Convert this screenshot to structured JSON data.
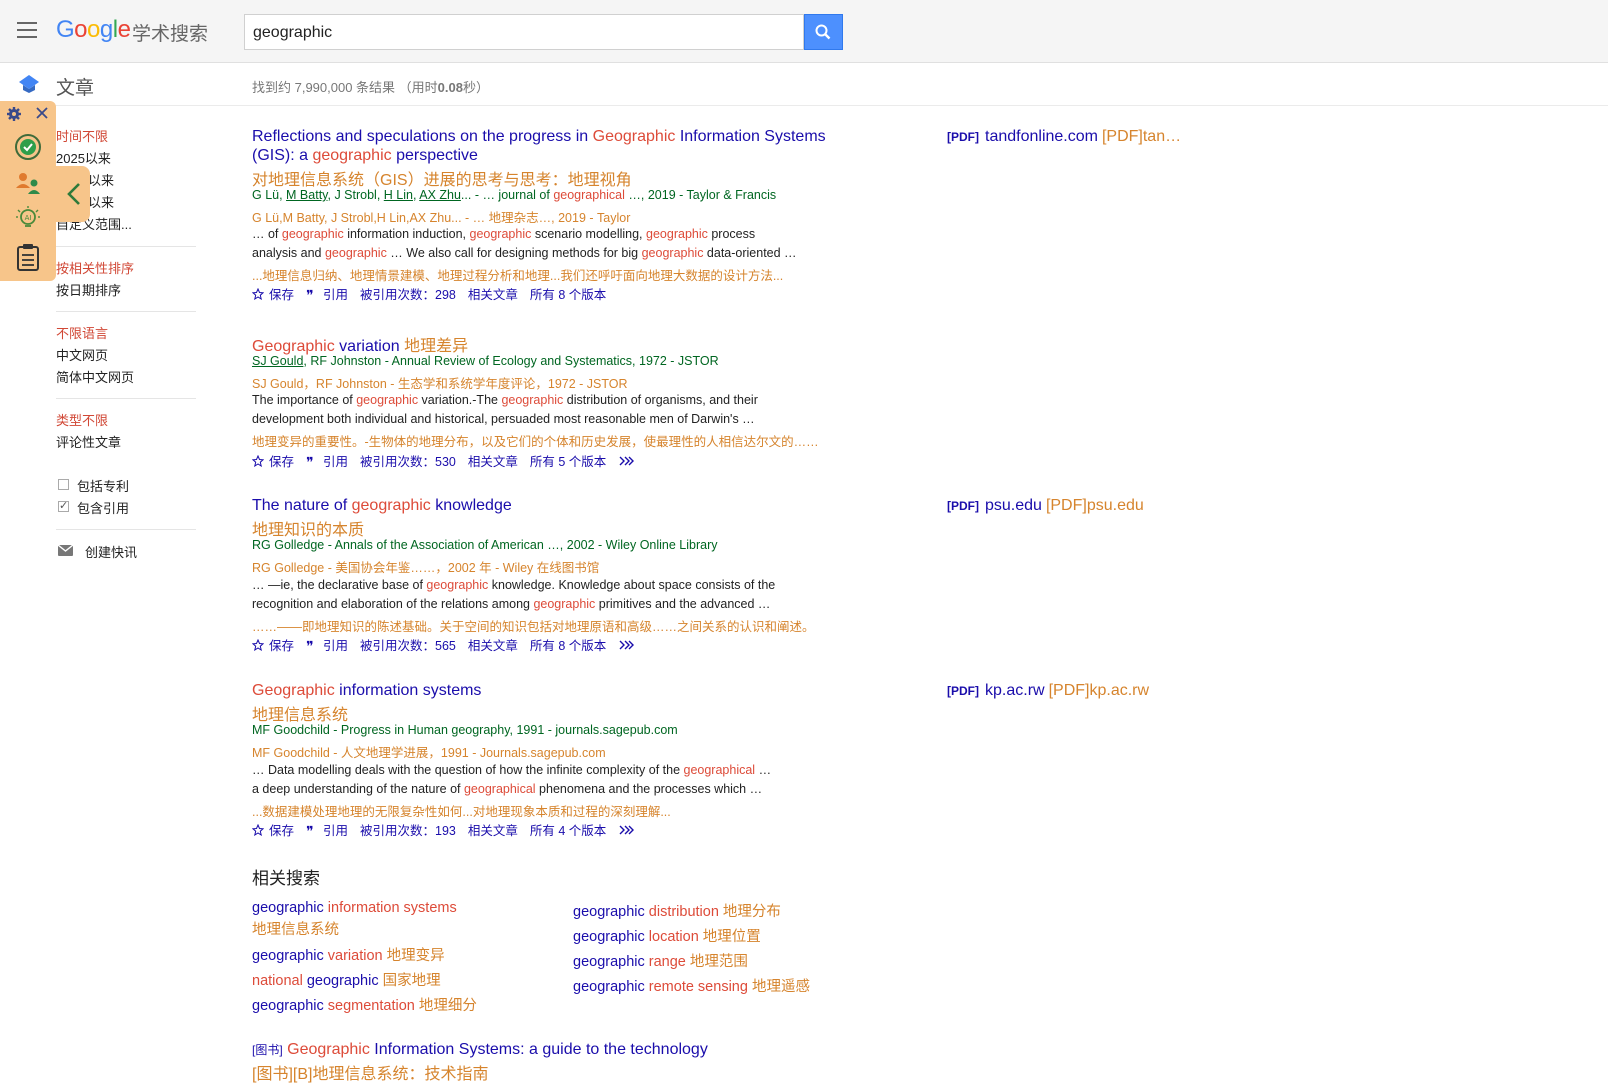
{
  "header": {
    "logo_google": "Google",
    "logo_sub": "学术搜索",
    "search_value": "geographic"
  },
  "subheader": {
    "section_title": "文章",
    "result_count_prefix": "找到约 7,990,000 条结果 （用时",
    "result_time": "0.08",
    "result_count_suffix": "秒）"
  },
  "sidebar": {
    "time_any": "时间不限",
    "since_2025": "2025以来",
    "since_b": "以来",
    "since_c": "以来",
    "custom_range": "自定义范围...",
    "sort_relevance": "按相关性排序",
    "sort_date": "按日期排序",
    "lang_any": "不限语言",
    "lang_zh": "中文网页",
    "lang_zh_simplified": "简体中文网页",
    "type_any": "类型不限",
    "type_review": "评论性文章",
    "include_patents": "包括专利",
    "include_citations": "包含引用",
    "create_alert": "创建快讯"
  },
  "results": [
    {
      "title_pre": "Reflections and speculations on the progress in ",
      "title_hl": "Geographic",
      "title_post": " Information Systems",
      "title_line2_pre": "(GIS): a ",
      "title_line2_hl": "geographic",
      "title_line2_post": " perspective",
      "title_tr": "对地理信息系统（GIS）进展的思考与思考：地理视角",
      "authors_plain1": "G Lü, ",
      "author_u1": "M Batty",
      "authors_plain2": ", J Strobl, ",
      "author_u2": "H Lin",
      "authors_plain3": ", ",
      "author_u3": "AX Zhu",
      "meta_rest_a": "... - … journal of ",
      "meta_hl": "geographical",
      "meta_rest_b": " …, 2019 - Taylor & Francis",
      "meta_tr": "G Lü,M Batty, J Strobl,H Lin,AX Zhu... - … 地理杂志…, 2019 - Taylor",
      "snip1_a": "… of ",
      "snip1_h1": "geographic",
      "snip1_b": " information induction, ",
      "snip1_h2": "geographic",
      "snip1_c": " scenario modelling, ",
      "snip1_h3": "geographic",
      "snip1_d": " process",
      "snip2_a": "analysis and ",
      "snip2_h1": "geographic",
      "snip2_b": " … We also call for designing methods for big ",
      "snip2_h2": "geographic",
      "snip2_c": " data-oriented …",
      "snip_tr": "...地理信息归纳、地理情景建模、地理过程分析和地理...我们还呼吁面向地理大数据的设计方法...",
      "save": "保存",
      "cite": "引用",
      "cited_by": "被引用次数：298",
      "related": "相关文章",
      "versions": "所有 8 个版本",
      "pdf_label": "[PDF]",
      "pdf_domain": "tandfonline.com",
      "pdf_tr": "[PDF]tan…"
    },
    {
      "title_hl": "Geographic",
      "title_post": " variation ",
      "title_tr_inline": "地理差异",
      "author_u1": "SJ Gould",
      "meta_rest": ", RF Johnston - Annual Review of Ecology and Systematics, 1972 - JSTOR",
      "meta_tr": "SJ Gould，RF Johnston - 生态学和系统学年度评论，1972 - JSTOR",
      "snip1_a": "The importance of ",
      "snip1_h1": "geographic",
      "snip1_b": " variation.-The ",
      "snip1_h2": "geographic",
      "snip1_c": " distribution of organisms, and their",
      "snip2": "development both individual and historical, persuaded most reasonable men of Darwin's …",
      "snip_tr": "地理变异的重要性。-生物体的地理分布，以及它们的个体和历史发展，使最理性的人相信达尔文的……",
      "save": "保存",
      "cite": "引用",
      "cited_by": "被引用次数：530",
      "related": "相关文章",
      "versions": "所有 5 个版本"
    },
    {
      "title_pre": "The nature of ",
      "title_hl": "geographic",
      "title_post": " knowledge",
      "title_tr": "地理知识的本质",
      "meta": "RG Golledge - Annals of the Association of American …, 2002 - Wiley Online Library",
      "meta_tr": "RG Golledge - 美国协会年鉴……，2002 年 - Wiley 在线图书馆",
      "snip1_a": "… —ie, the declarative base of ",
      "snip1_h1": "geographic",
      "snip1_b": " knowledge. Knowledge about space consists of the",
      "snip2_a": "recognition and elaboration of the relations among ",
      "snip2_h1": "geographic",
      "snip2_b": " primitives and the advanced …",
      "snip_tr": "……——即地理知识的陈述基础。关于空间的知识包括对地理原语和高级……之间关系的认识和阐述。",
      "save": "保存",
      "cite": "引用",
      "cited_by": "被引用次数：565",
      "related": "相关文章",
      "versions": "所有 8 个版本",
      "pdf_label": "[PDF]",
      "pdf_domain": "psu.edu",
      "pdf_tr": "[PDF]psu.edu"
    },
    {
      "title_hl": "Geographic",
      "title_post": " information systems",
      "title_tr": "地理信息系统",
      "meta": "MF Goodchild - Progress in Human geography, 1991 - journals.sagepub.com",
      "meta_tr": "MF Goodchild - 人文地理学进展，1991 - Journals.sagepub.com",
      "snip1_a": "… Data modelling deals with the question of how the infinite complexity of the ",
      "snip1_h1": "geographical",
      "snip1_b": " …",
      "snip2_a": "a deep understanding of the nature of ",
      "snip2_h1": "geographical",
      "snip2_b": " phenomena and the processes which …",
      "snip_tr": "...数据建模处理地理的无限复杂性如何...对地理现象本质和过程的深刻理解...",
      "save": "保存",
      "cite": "引用",
      "cited_by": "被引用次数：193",
      "related": "相关文章",
      "versions": "所有 4 个版本",
      "pdf_label": "[PDF]",
      "pdf_domain": "kp.ac.rw",
      "pdf_tr": "[PDF]kp.ac.rw"
    }
  ],
  "related_searches": {
    "heading": "相关搜索",
    "left": [
      {
        "a": "geographic",
        "b": " information systems",
        "tr": ""
      },
      {
        "a": "",
        "b": "",
        "tr": "地理信息系统"
      },
      {
        "a": "geographic",
        "b": " variation",
        "tr": " 地理变异"
      },
      {
        "a": "national",
        "b": " geographic",
        "tr": " 国家地理"
      },
      {
        "a": "geographic",
        "b": " segmentation",
        "tr": " 地理细分"
      }
    ],
    "right": [
      {
        "a": "geographic",
        "b": " distribution",
        "tr": " 地理分布"
      },
      {
        "a": "geographic",
        "b": " location",
        "tr": " 地理位置"
      },
      {
        "a": "geographic",
        "b": " range",
        "tr": " 地理范围"
      },
      {
        "a": "geographic",
        "b": " remote sensing",
        "tr": " 地理遥感"
      }
    ]
  },
  "book_result": {
    "tag": "[图书]",
    "title_hl": " Geographic",
    "title_post": " Information Systems: a guide to the technology",
    "title_tr": "[图书][B]地理信息系统：技术指南"
  },
  "colors": {
    "link": "#1a0dab",
    "highlight": "#dd4b39",
    "translation": "#d6842d",
    "meta_green": "#006621",
    "search_button": "#4d90fe",
    "extension_panel": "#f7c58a"
  }
}
